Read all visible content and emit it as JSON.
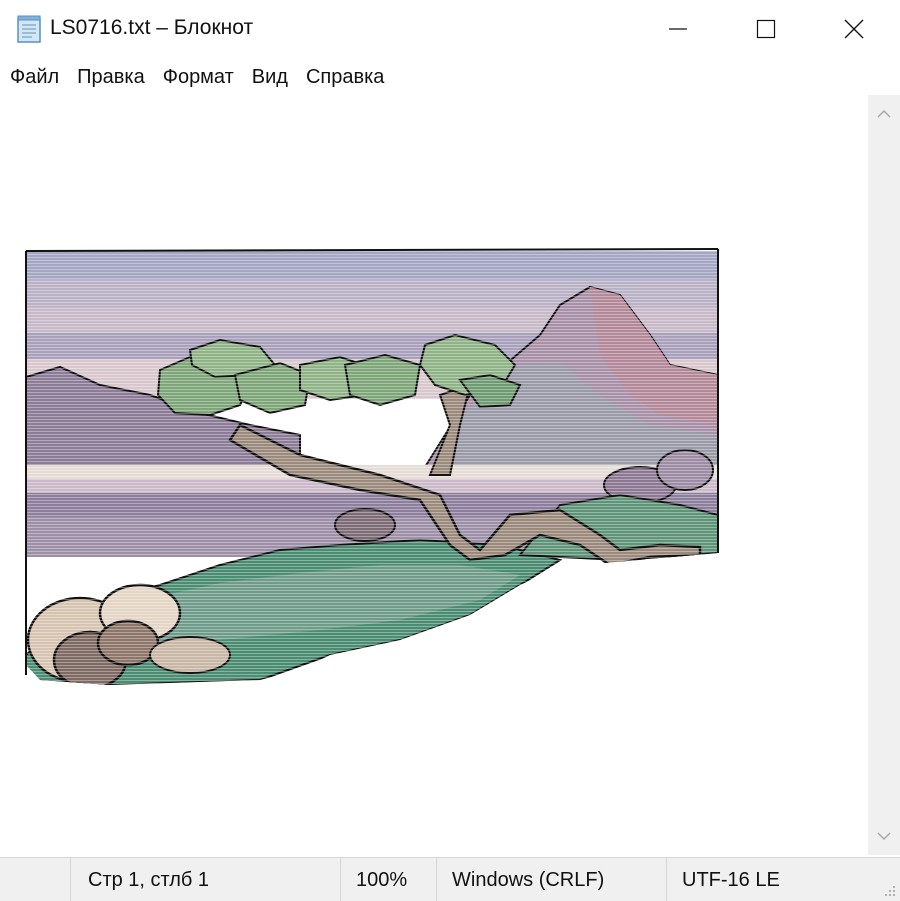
{
  "window": {
    "title": "LS0716.txt – Блокнот",
    "icons": [
      "notepad-icon",
      "minimize-icon",
      "maximize-icon",
      "close-icon"
    ]
  },
  "menu": {
    "items": [
      "Файл",
      "Правка",
      "Формат",
      "Вид",
      "Справка"
    ]
  },
  "editor": {
    "content": "ascii-art landscape: bonsai tree, mountains, lake and rocks"
  },
  "status": {
    "position": "Стр 1, стлб 1",
    "zoom": "100%",
    "line_endings": "Windows (CRLF)",
    "encoding": "UTF-16 LE"
  },
  "colors": {
    "scrollbar": "#f0f0f0",
    "statusbar": "#f0f0f0"
  }
}
